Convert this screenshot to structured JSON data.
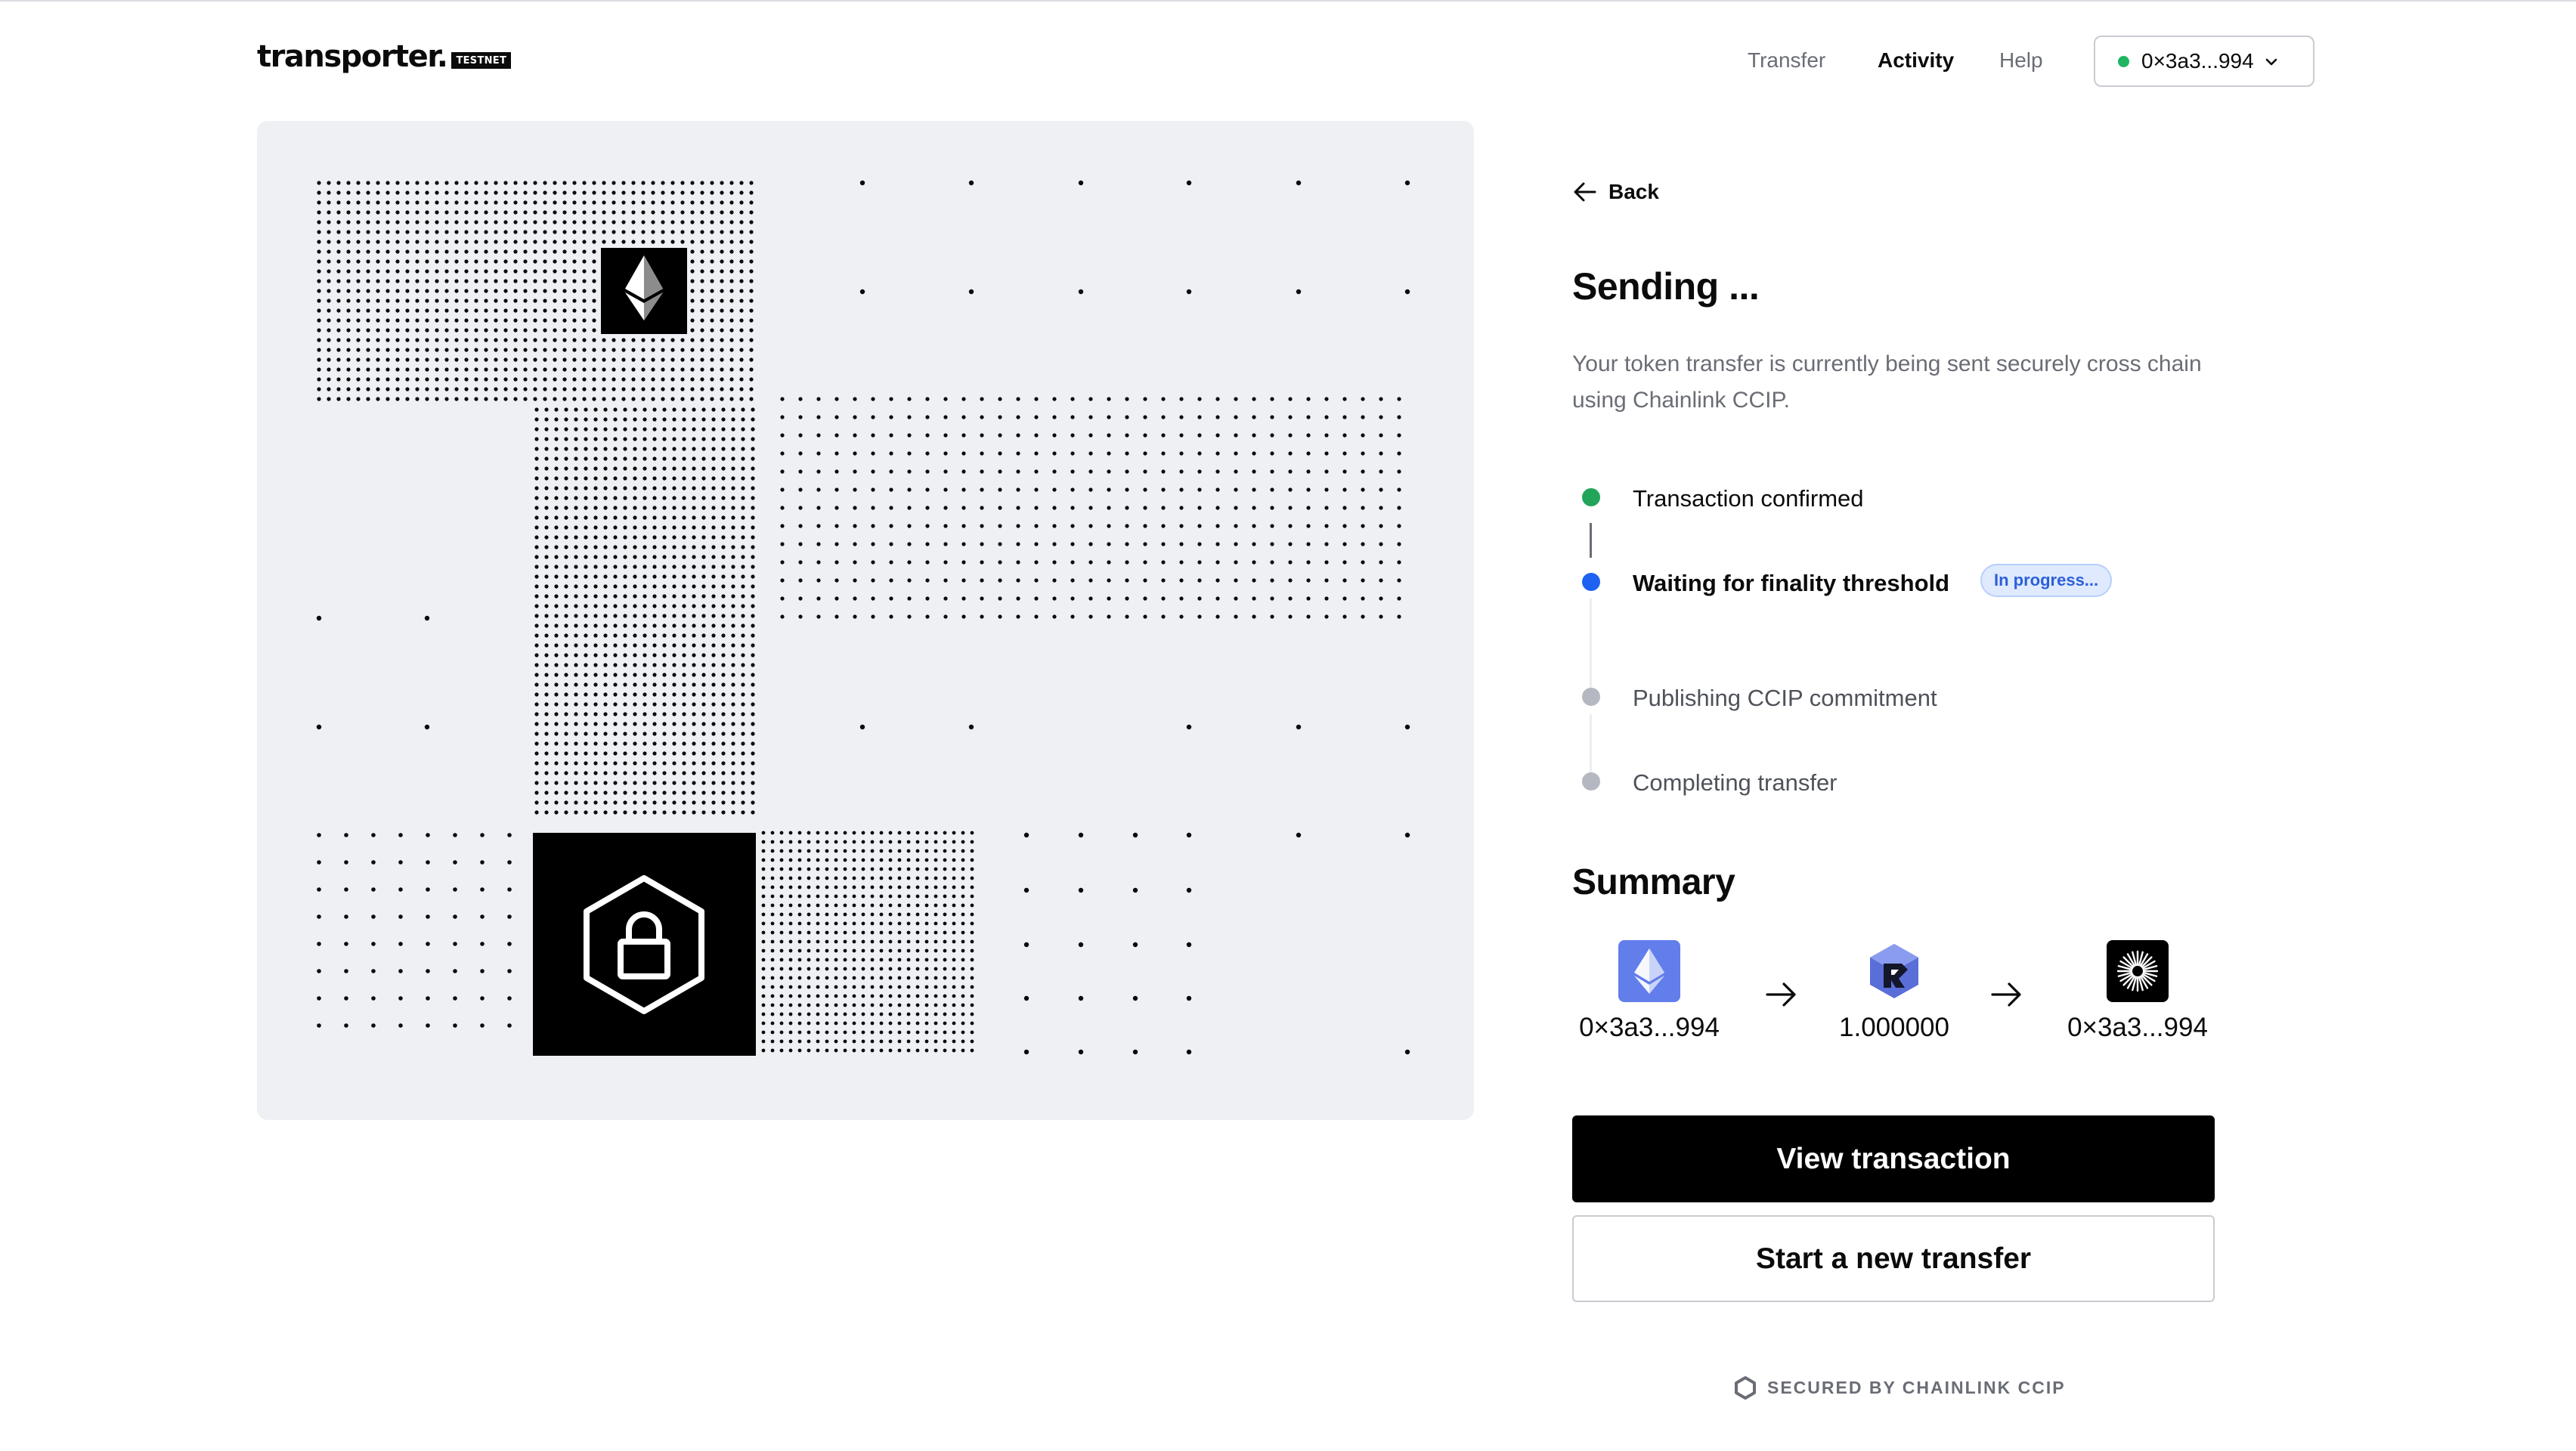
{
  "app": {
    "name": "transporter.",
    "badge": "TESTNET"
  },
  "nav": {
    "transfer": "Transfer",
    "activity": "Activity",
    "help": "Help"
  },
  "wallet": {
    "address": "0×3a3...994",
    "status_color": "#1fb560"
  },
  "back_label": "Back",
  "status": {
    "title": "Sending ...",
    "description": "Your token transfer is currently being sent securely cross chain using Chainlink CCIP."
  },
  "steps": [
    {
      "label": "Transaction confirmed",
      "state": "done",
      "color": "#22a55a"
    },
    {
      "label": "Waiting for finality threshold",
      "state": "active",
      "color": "#1f62f2",
      "badge": "In progress..."
    },
    {
      "label": "Publishing CCIP commitment",
      "state": "pending",
      "color": "#b5b8c0"
    },
    {
      "label": "Completing transfer",
      "state": "pending",
      "color": "#b5b8c0"
    }
  ],
  "summary": {
    "title": "Summary",
    "from": {
      "label": "0×3a3...994",
      "icon": "ethereum-icon"
    },
    "amount": {
      "label": "1.000000",
      "icon": "token-icon"
    },
    "to": {
      "label": "0×3a3...994",
      "icon": "destination-chain-icon"
    }
  },
  "buttons": {
    "view": "View transaction",
    "new": "Start a new transfer"
  },
  "footer": {
    "secured": "SECURED BY CHAINLINK CCIP"
  },
  "colors": {
    "accent_blue": "#627eea",
    "panel_bg": "#eff0f4"
  }
}
